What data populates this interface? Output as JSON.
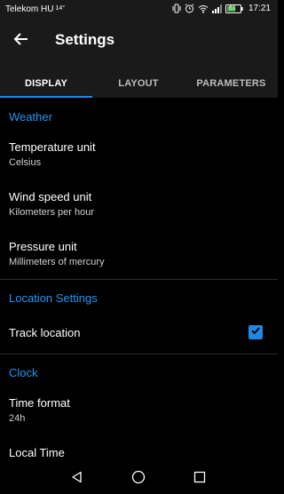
{
  "status_bar": {
    "carrier": "Telekom HU",
    "temperature": "14°",
    "battery": "61",
    "time": "17:21",
    "icons": [
      "vibrate-icon",
      "alarm-icon",
      "wifi-icon",
      "signal-icon",
      "battery-icon"
    ]
  },
  "app_bar": {
    "title": "Settings",
    "back_icon": "arrow-back-icon"
  },
  "tabs": [
    {
      "label": "DISPLAY",
      "active": true
    },
    {
      "label": "LAYOUT",
      "active": false
    },
    {
      "label": "PARAMETERS",
      "active": false
    }
  ],
  "sections": {
    "weather": {
      "header": "Weather",
      "items": [
        {
          "title": "Temperature unit",
          "summary": "Celsius"
        },
        {
          "title": "Wind speed unit",
          "summary": "Kilometers per hour"
        },
        {
          "title": "Pressure unit",
          "summary": "Millimeters of mercury"
        }
      ]
    },
    "location": {
      "header": "Location Settings",
      "items": [
        {
          "title": "Track location",
          "checked": true
        }
      ]
    },
    "clock": {
      "header": "Clock",
      "items": [
        {
          "title": "Time format",
          "summary": "24h"
        },
        {
          "title": "Local Time",
          "summary": ""
        }
      ]
    }
  },
  "nav_bar": {
    "icons": [
      "back-triangle-icon",
      "home-circle-icon",
      "recents-square-icon"
    ]
  },
  "colors": {
    "accent": "#2196f3",
    "background": "#000000",
    "bar_background": "#1a1a1a"
  }
}
